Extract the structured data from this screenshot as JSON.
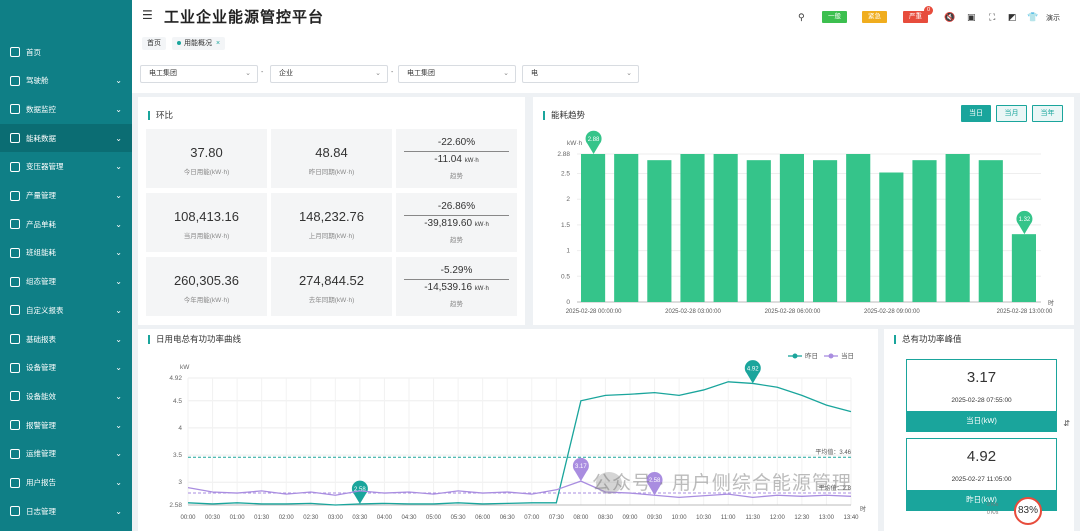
{
  "app": {
    "title": "工业企业能源管控平台",
    "tabs": [
      {
        "label": "首页"
      },
      {
        "label": "用能概况"
      }
    ],
    "tab_close": "×"
  },
  "header": {
    "badges": [
      {
        "label": "一般",
        "color": "#3cbf4f"
      },
      {
        "label": "紧急",
        "color": "#f0ad1e"
      },
      {
        "label": "严重",
        "color": "#e74c3c"
      }
    ],
    "badge_count": "0",
    "demo_label": "演示"
  },
  "sidebar": {
    "items": [
      {
        "label": "首页"
      },
      {
        "label": "驾驶舱"
      },
      {
        "label": "数据监控"
      },
      {
        "label": "能耗数据"
      },
      {
        "label": "变压器管理"
      },
      {
        "label": "产量管理"
      },
      {
        "label": "产品单耗"
      },
      {
        "label": "班组能耗"
      },
      {
        "label": "组态管理"
      },
      {
        "label": "自定义报表"
      },
      {
        "label": "基础报表"
      },
      {
        "label": "设备管理"
      },
      {
        "label": "设备能效"
      },
      {
        "label": "报警管理"
      },
      {
        "label": "运维管理"
      },
      {
        "label": "用户报告"
      },
      {
        "label": "日志管理"
      }
    ]
  },
  "filters": {
    "values": [
      "电工集团",
      "企业",
      "电工集团",
      "电"
    ],
    "sep": "-"
  },
  "ratio": {
    "title": "环比",
    "cards": [
      {
        "value": "37.80",
        "label": "今日用能(kW·h)"
      },
      {
        "value": "48.84",
        "label": "昨日同期(kW·h)"
      },
      {
        "pct": "-22.60%",
        "diff": "-11.04",
        "unit": "kW·h",
        "trend": "趋势"
      },
      {
        "value": "108,413.16",
        "label": "当月用能(kW·h)"
      },
      {
        "value": "148,232.76",
        "label": "上月同期(kW·h)"
      },
      {
        "pct": "-26.86%",
        "diff": "-39,819.60",
        "unit": "kW·h",
        "trend": "趋势"
      },
      {
        "value": "260,305.36",
        "label": "今年用能(kW·h)"
      },
      {
        "value": "274,844.52",
        "label": "去年同期(kW·h)"
      },
      {
        "pct": "-5.29%",
        "diff": "-14,539.16",
        "unit": "kW·h",
        "trend": "趋势"
      }
    ]
  },
  "trend": {
    "title": "能耗趋势",
    "buttons": [
      "当日",
      "当月",
      "当年"
    ]
  },
  "power": {
    "title": "日用电总有功功率曲线"
  },
  "peak": {
    "title": "总有功功率峰值",
    "boxes": [
      {
        "value": "3.17",
        "time": "2025-02-28 07:55:00",
        "footer": "当日(kW)"
      },
      {
        "value": "4.92",
        "time": "2025-02-27 11:05:00",
        "footer": "昨日(kW)"
      }
    ]
  },
  "watermark": "公众号 · 用户侧综合能源管理",
  "gauge": "83%",
  "net": [
    "0 K/s",
    "0 K/s"
  ],
  "chart_data": [
    {
      "type": "bar",
      "title": "能耗趋势",
      "ylabel": "kW·h",
      "xlabel": "时",
      "ylim": [
        0,
        2.88
      ],
      "yticks": [
        "0",
        "0.5",
        "1",
        "1.5",
        "2",
        "2.5",
        "2.88"
      ],
      "x_tick_labels": [
        "2025-02-28 00:00:00",
        "2025-02-28 03:00:00",
        "2025-02-28 06:00:00",
        "2025-02-28 09:00:00",
        "2025-02-28 13:00:00"
      ],
      "categories": [
        "2025-02-28 00:00:00",
        "2025-02-28 01:00:00",
        "2025-02-28 02:00:00",
        "2025-02-28 03:00:00",
        "2025-02-28 04:00:00",
        "2025-02-28 05:00:00",
        "2025-02-28 06:00:00",
        "2025-02-28 07:00:00",
        "2025-02-28 08:00:00",
        "2025-02-28 09:00:00",
        "2025-02-28 10:00:00",
        "2025-02-28 11:00:00",
        "2025-02-28 12:00:00",
        "2025-02-28 13:00:00"
      ],
      "values": [
        2.88,
        2.88,
        2.76,
        2.88,
        2.88,
        2.76,
        2.88,
        2.76,
        2.88,
        2.52,
        2.76,
        2.88,
        2.76,
        1.32
      ],
      "markers": [
        {
          "index": 0,
          "label": "2.88"
        },
        {
          "index": 13,
          "label": "1.32"
        }
      ],
      "color": "#35c48a"
    },
    {
      "type": "line",
      "title": "日用电总有功功率曲线",
      "ylabel": "kW",
      "xlabel": "时",
      "ylim": [
        2.58,
        4.92
      ],
      "yticks": [
        "2.58",
        "3",
        "3.5",
        "4",
        "4.5",
        "4.92"
      ],
      "x": [
        "00:00",
        "00:30",
        "01:00",
        "01:30",
        "02:00",
        "02:30",
        "03:00",
        "03:30",
        "04:00",
        "04:30",
        "05:00",
        "05:30",
        "06:00",
        "06:30",
        "07:00",
        "07:30",
        "08:00",
        "08:30",
        "09:00",
        "09:30",
        "10:00",
        "10:30",
        "11:00",
        "11:30",
        "12:00",
        "12:30",
        "13:00",
        "13:40"
      ],
      "series": [
        {
          "name": "昨日",
          "color": "#1aa59c",
          "values": [
            2.62,
            2.6,
            2.62,
            2.6,
            2.6,
            2.61,
            2.58,
            2.6,
            2.61,
            2.6,
            2.6,
            2.62,
            2.6,
            2.61,
            2.62,
            2.62,
            4.5,
            4.6,
            4.62,
            4.65,
            4.6,
            4.7,
            4.85,
            4.82,
            4.75,
            4.6,
            4.42,
            4.3
          ],
          "markers": [
            {
              "x": "03:30",
              "label": "2.58"
            },
            {
              "x": "11:30",
              "label": "4.92"
            }
          ]
        },
        {
          "name": "当日",
          "color": "#a98de0",
          "values": [
            2.9,
            2.82,
            2.8,
            2.84,
            2.78,
            2.82,
            2.76,
            2.84,
            2.8,
            2.82,
            2.78,
            2.84,
            2.8,
            2.82,
            2.78,
            2.86,
            3.02,
            2.82,
            2.8,
            2.76,
            2.72,
            2.75,
            2.78,
            2.72,
            2.76,
            2.74,
            2.76,
            2.74
          ],
          "markers": [
            {
              "x": "08:00",
              "label": "3.17"
            },
            {
              "x": "09:30",
              "label": "2.58"
            }
          ]
        }
      ],
      "avg_lines": [
        {
          "label": "平均值：3.46",
          "value": 3.46
        },
        {
          "label": "平均值：2.8",
          "value": 2.8
        }
      ]
    }
  ]
}
